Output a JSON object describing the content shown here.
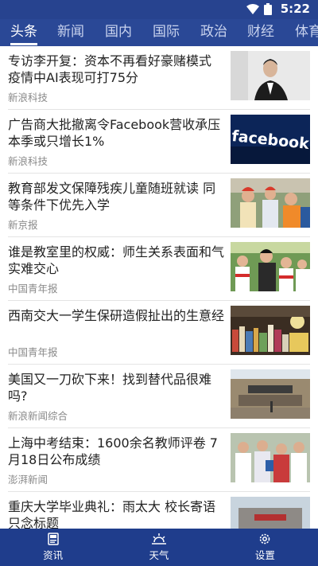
{
  "status_bar": {
    "time": "5:22",
    "icons": [
      "wifi-icon",
      "battery-icon"
    ]
  },
  "tabs": [
    {
      "label": "头条",
      "active": true
    },
    {
      "label": "新闻"
    },
    {
      "label": "国内"
    },
    {
      "label": "国际"
    },
    {
      "label": "政治"
    },
    {
      "label": "财经"
    },
    {
      "label": "体育"
    }
  ],
  "news": [
    {
      "title": "专访李开复：资本不再看好豪赌模式 疫情中AI表现可打75分",
      "source": "新浪科技",
      "thumb": "portrait-photo"
    },
    {
      "title": "广告商大批撤离令Facebook营收承压 本季或只增长1%",
      "source": "新浪科技",
      "thumb": "facebook-logo",
      "thumb_text": "facebook"
    },
    {
      "title": "教育部发文保障残疾儿童随班就读 同等条件下优先入学",
      "source": "新京报",
      "thumb": "children-photo"
    },
    {
      "title": "谁是教室里的权威：师生关系表面和气 实难交心",
      "source": "中国青年报",
      "thumb": "classroom-photo"
    },
    {
      "title": "西南交大一学生保研造假扯出的生意经",
      "source": "中国青年报",
      "thumb": "books-photo"
    },
    {
      "title": "美国又一刀砍下来！找到替代品很难吗?",
      "source": "新浪新闻综合",
      "thumb": "building-photo"
    },
    {
      "title": "上海中考结束：1600余名教师评卷 7月18日公布成绩",
      "source": "澎湃新闻",
      "thumb": "students-photo"
    },
    {
      "title": "重庆大学毕业典礼：雨太大 校长寄语只念标题",
      "source": "",
      "thumb": "campus-photo"
    }
  ],
  "bottom_nav": [
    {
      "label": "资讯",
      "icon": "news-icon"
    },
    {
      "label": "天气",
      "icon": "weather-icon"
    },
    {
      "label": "设置",
      "icon": "settings-icon"
    }
  ],
  "colors": {
    "header": "#2a4896",
    "bottom_bar": "#1f3d8c"
  }
}
